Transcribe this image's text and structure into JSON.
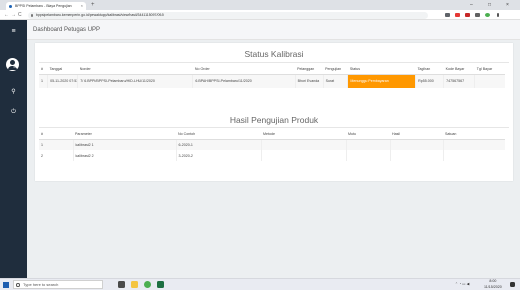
{
  "browser": {
    "tab_title": "BPPSI Pelambaru - Biaya Pengujian",
    "tab_close": "×",
    "new_tab": "+",
    "url": "bppsipelambaru.kemenperin.go.id/pewaktupp/kalibrasi/view/hasil/3441115097/09Ji",
    "window_controls": [
      "–",
      "□",
      "×"
    ],
    "nav": [
      "←",
      "→",
      "C"
    ]
  },
  "app": {
    "header_title": "Dashboard Petugas UPP",
    "sidebar_badge": "TO"
  },
  "status_kalibrasi": {
    "title": "Status Kalibrasi",
    "columns": [
      "#",
      "Tanggal",
      "Norder",
      "No Order",
      "Pelanggan",
      "Pengujian",
      "Status",
      "Tagihan",
      "Kode Bayar",
      "Tgl Bayar"
    ],
    "rows": [
      [
        "1",
        "05-11-2020 07:53:49",
        "7/ 6.BPPI/BPPSI-Pelambaru/HID-LHU/11/2020",
        "6.BPAH/BPPSI-Pelambaru/11/2020",
        "Bhori Evanda",
        "Surat",
        "Menunggu Pembayaran",
        "Rp55.000",
        "747567567",
        ""
      ]
    ]
  },
  "hasil_pengujian": {
    "title": "Hasil Pengujian Produk",
    "columns": [
      "#",
      "Parameter",
      "No Contoh",
      "Metode",
      "Mutu",
      "Hasil",
      "Satuan"
    ],
    "rows": [
      [
        "1",
        "kalibrasi2 1",
        "6-2020-1",
        "",
        "",
        "",
        ""
      ],
      [
        "2",
        "kalibrasi2 2",
        "3-2020-2",
        "",
        "",
        "",
        ""
      ]
    ]
  },
  "taskbar": {
    "search_placeholder": "Type here to search",
    "time": "8:00",
    "date": "11/15/2020"
  },
  "colors": {
    "sidebar": "#1f2d3d",
    "status_badge": "#ff9800"
  }
}
